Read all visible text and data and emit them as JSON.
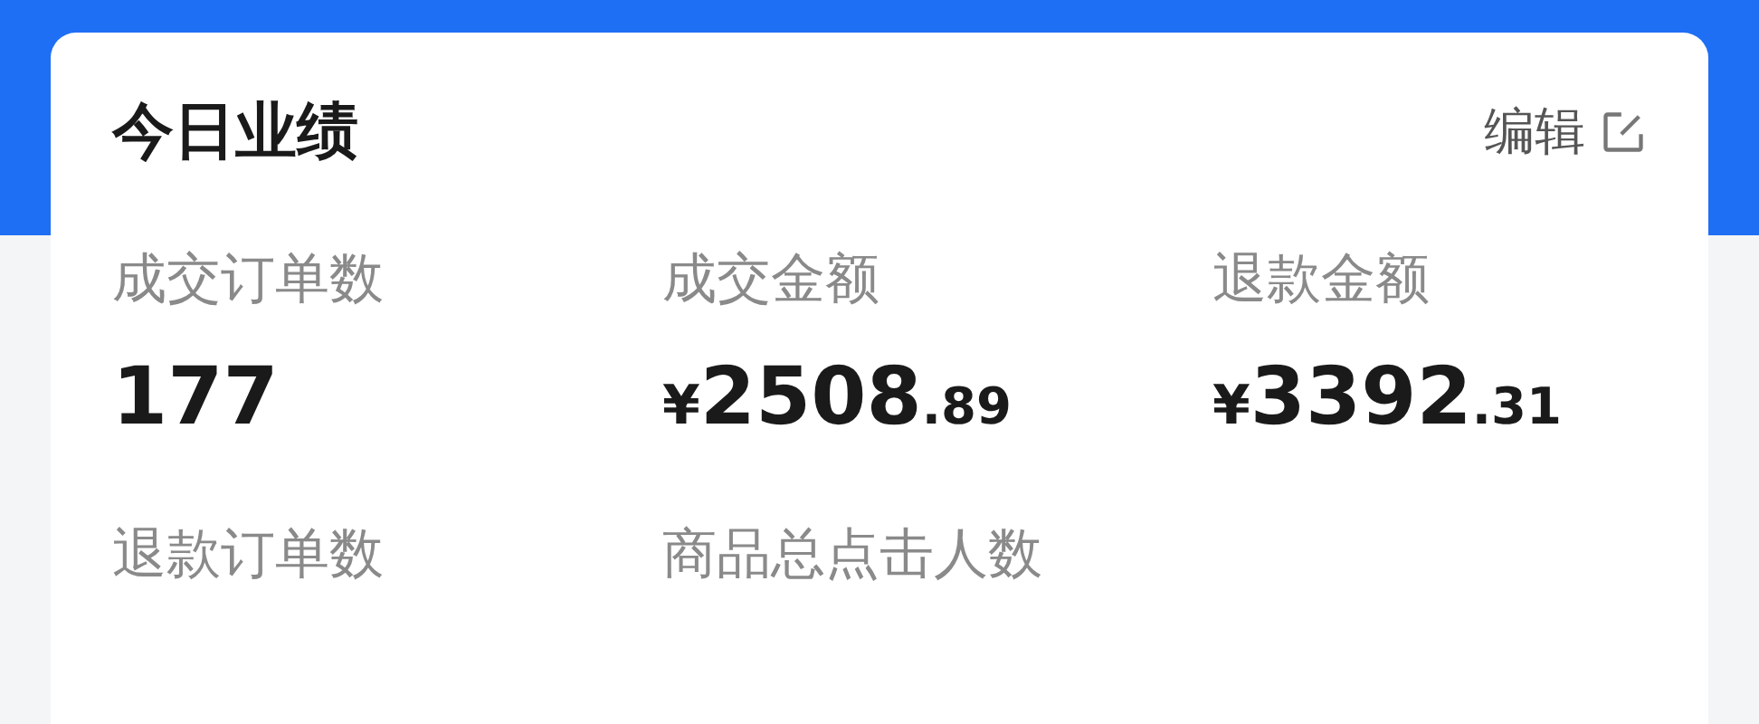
{
  "card": {
    "title": "今日业绩",
    "edit_label": "编辑"
  },
  "metrics": [
    {
      "label": "成交订单数",
      "number": "177"
    },
    {
      "label": "成交金额",
      "currency": "¥",
      "number": "2508",
      "fraction": ".89"
    },
    {
      "label": "退款金额",
      "currency": "¥",
      "number": "3392",
      "fraction": ".31"
    },
    {
      "label": "退款订单数"
    },
    {
      "label": "商品总点击人数"
    }
  ]
}
